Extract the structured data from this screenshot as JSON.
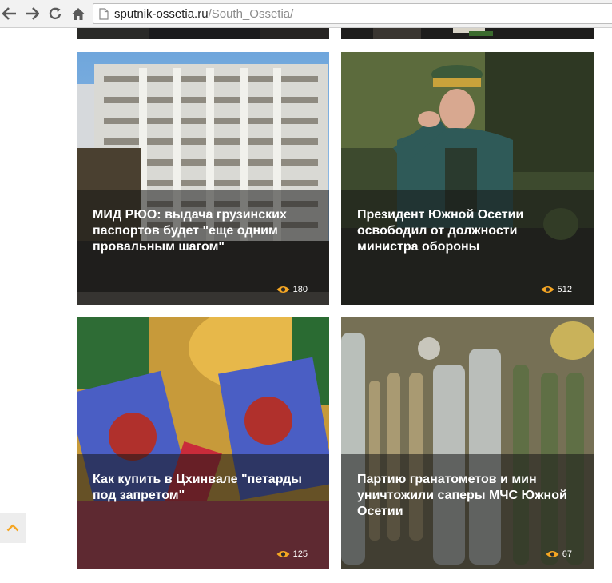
{
  "browser": {
    "url_host": "sputnik-ossetia.ru",
    "url_path": "/South_Ossetia/"
  },
  "colors": {
    "accent_orange": "#f5a623",
    "overlay": "rgba(22,22,22,0.55)"
  },
  "icons": {
    "back": "back-arrow-icon",
    "forward": "forward-arrow-icon",
    "reload": "reload-icon",
    "home": "home-icon",
    "page": "page-icon",
    "views": "eye-icon",
    "scroll_top": "chevron-up-icon"
  },
  "cards": [
    {
      "title": "МИД РЮО: выдача грузинских паспортов будет \"еще одним провальным шагом\"",
      "views": "180"
    },
    {
      "title": "Президент Южной Осетии освободил от должности министра обороны",
      "views": "512"
    },
    {
      "title": "Как купить в Цхинвале \"петарды под запретом\"",
      "views": "125"
    },
    {
      "title": "Партию гранатометов и мин уничтожили саперы МЧС Южной Осетии",
      "views": "67"
    }
  ]
}
